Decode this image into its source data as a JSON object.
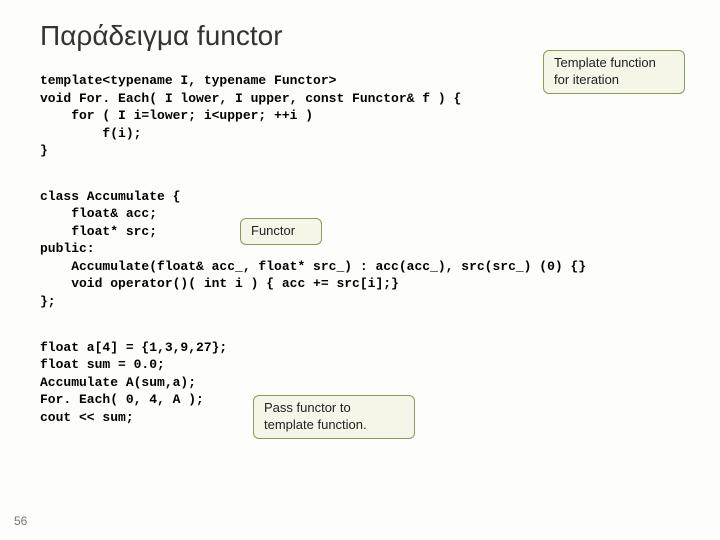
{
  "title": "Παράδειγμα functor",
  "callouts": {
    "c1": "Template function for iteration",
    "c2": "Functor",
    "c3": "Pass functor to template function."
  },
  "code": {
    "block1": "template<typename I, typename Functor>\nvoid For. Each( I lower, I upper, const Functor& f ) {\n    for ( I i=lower; i<upper; ++i )\n        f(i);\n}",
    "block2": "class Accumulate {\n    float& acc;\n    float* src;\npublic:\n    Accumulate(float& acc_, float* src_) : acc(acc_), src(src_) (0) {}\n    void operator()( int i ) { acc += src[i];}\n};",
    "block3": "float a[4] = {1,3,9,27};\nfloat sum = 0.0;\nAccumulate A(sum,a);\nFor. Each( 0, 4, A );\ncout << sum;"
  },
  "page_number": "56"
}
